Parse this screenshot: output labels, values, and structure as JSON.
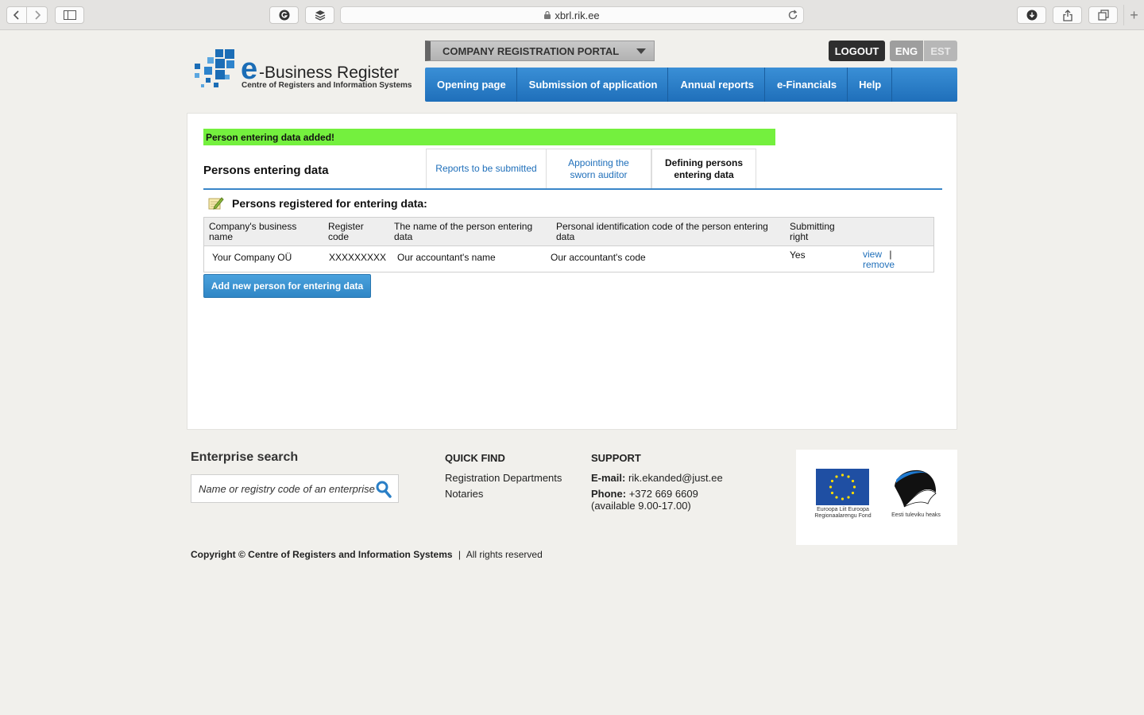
{
  "browser": {
    "url": "xbrl.rik.ee"
  },
  "header": {
    "logo_letter": "e",
    "logo_title": "-Business Register",
    "logo_subtitle": "Centre of Registers and Information Systems",
    "portal_label": "COMPANY REGISTRATION PORTAL",
    "logout_label": "LOGOUT",
    "lang_eng": "ENG",
    "lang_est": "EST",
    "nav": [
      {
        "label": "Opening page"
      },
      {
        "label": "Submission of application"
      },
      {
        "label": "Annual reports"
      },
      {
        "label": "e-Financials"
      },
      {
        "label": "Help"
      }
    ]
  },
  "main": {
    "alert": "Person entering data added!",
    "title": "Persons entering data",
    "tabs": [
      {
        "label": "Reports to be submitted"
      },
      {
        "label": "Appointing the sworn auditor"
      },
      {
        "label": "Defining persons entering data"
      }
    ],
    "section_title": "Persons registered for entering data:",
    "table": {
      "headers": [
        "Company's business name",
        "Register code",
        "The name of the person entering data",
        "Personal identification code of the person entering data",
        "Submitting right"
      ],
      "rows": [
        {
          "company": "Your Company OÜ",
          "register_code": "XXXXXXXXX",
          "person_name": "Our accountant's name",
          "person_code": "Our accountant's code",
          "submitting_right": "Yes",
          "view": "view",
          "separator": "|",
          "remove": "remove"
        }
      ]
    },
    "add_button": "Add new person for entering data"
  },
  "footer": {
    "search_title": "Enterprise search",
    "search_placeholder": "Name or registry code of an enterprise",
    "quick_find_title": "QUICK FIND",
    "quick_find": [
      "Registration Departments",
      "Notaries"
    ],
    "support_title": "SUPPORT",
    "email_label": "E-mail:",
    "email": "rik.ekanded@just.ee",
    "phone_label": "Phone:",
    "phone": "+372 669 6609",
    "hours": "(available 9.00-17.00)",
    "eu_caption": "Euroopa Liit Euroopa Regionaalarengu Fond",
    "ee_caption": "Eesti tuleviku heaks",
    "copyright": "Copyright © Centre of Registers and Information Systems",
    "copyright_sep": "|",
    "rights": "All rights reserved"
  },
  "colors": {
    "nav_blue": "#1f6fba",
    "alert_green": "#74f03e",
    "button_blue": "#2f86c5"
  }
}
